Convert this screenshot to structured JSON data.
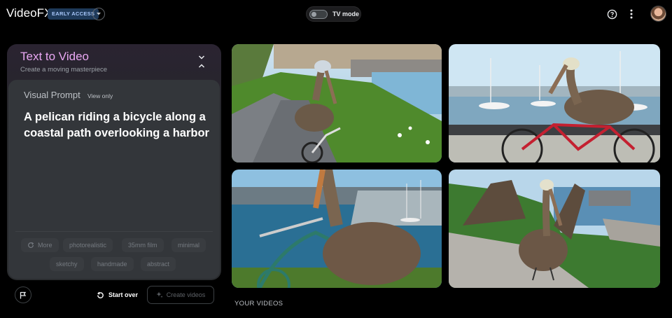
{
  "app": {
    "title": "VideoFX",
    "badge": "EARLY ACCESS"
  },
  "header": {
    "tv_mode_label": "TV mode",
    "tv_mode_on": false
  },
  "panel": {
    "title": "Text to Video",
    "subtitle": "Create a moving masterpiece",
    "prompt_label": "Visual Prompt",
    "prompt_mode": "View only",
    "prompt_text": "A pelican riding a bicycle along a coastal path overlooking a harbor",
    "chips": [
      "More",
      "photorealistic",
      "35mm film",
      "minimal",
      "sketchy",
      "handmade",
      "abstract"
    ],
    "start_over": "Start over",
    "create_videos": "Create videos"
  },
  "videos_section": {
    "label": "YOUR VIDEOS"
  },
  "colors": {
    "accent": "#e9a7f2",
    "badge_bg": "#1f3a5a",
    "badge_text": "#a8c7fa",
    "panel_bg": "#33363a"
  },
  "icons": [
    "chevron-down-icon",
    "help-icon",
    "more-vert-icon",
    "collapse-icon",
    "refresh-icon",
    "flag-icon",
    "sparkle-icon"
  ]
}
